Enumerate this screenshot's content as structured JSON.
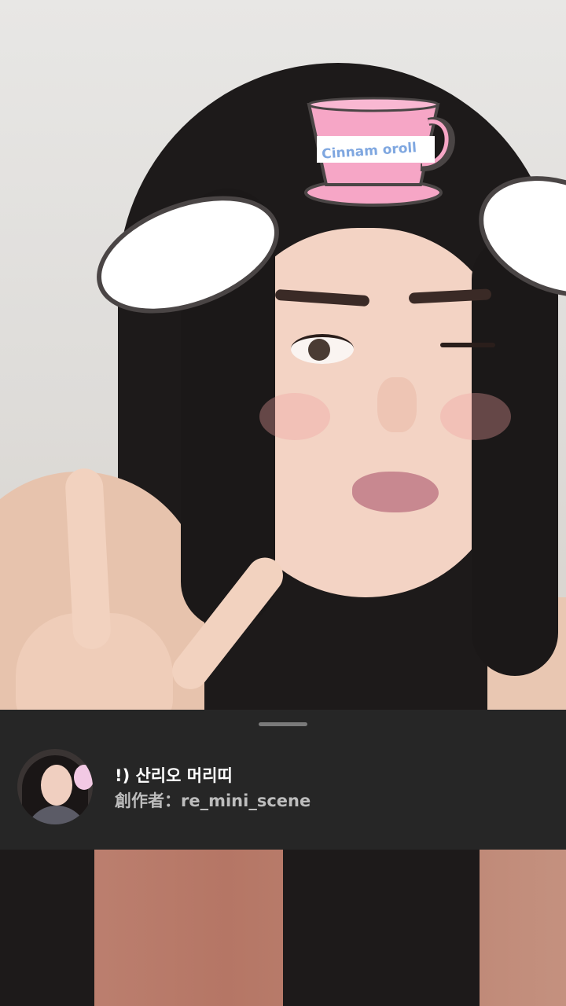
{
  "filter": {
    "cup_text": "Cinnam oroll",
    "overlay_colors": {
      "cup_fill": "#f6a6c6",
      "ear_fill": "#ffffff",
      "ear_outline": "#4a4545"
    }
  },
  "sheet": {
    "effect_title": "!) 산리오 머리띠",
    "creator_text": "創作者：re_mini_scene",
    "background": "#262626"
  }
}
